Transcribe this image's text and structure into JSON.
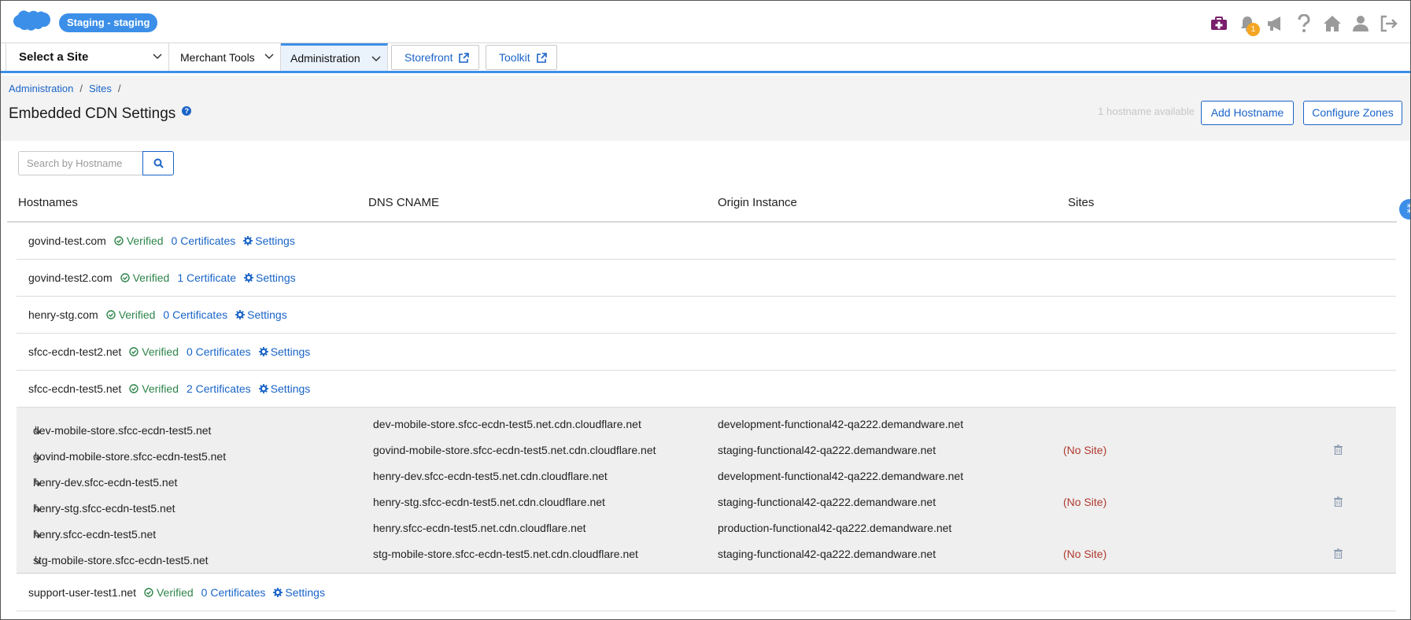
{
  "header": {
    "env_badge": "Staging - staging",
    "notification_count": "1",
    "icons": [
      "briefcase-plus-icon",
      "bell-icon",
      "megaphone-icon",
      "help-icon",
      "home-icon",
      "user-icon",
      "logout-icon"
    ],
    "brand_color": "#3c8fe8"
  },
  "nav": {
    "site_selector": "Select a Site",
    "merchant_tools": "Merchant Tools",
    "administration": "Administration",
    "storefront": "Storefront",
    "toolkit": "Toolkit"
  },
  "breadcrumb": {
    "items": [
      "Administration",
      "Sites"
    ],
    "separator": "/"
  },
  "page": {
    "title": "Embedded CDN Settings",
    "help": "?",
    "availability": "1 hostname available",
    "add_hostname": "Add Hostname",
    "configure_zones": "Configure Zones"
  },
  "search": {
    "placeholder": "Search by Hostname"
  },
  "table": {
    "columns": [
      "Hostnames",
      "DNS CNAME",
      "Origin Instance",
      "Sites"
    ],
    "side_handle": "⁑",
    "verified_label": "Verified",
    "settings_label": "Settings",
    "hostnames": [
      {
        "host": "govind-test.com",
        "certs": "0 Certificates"
      },
      {
        "host": "govind-test2.com",
        "certs": "1 Certificate"
      },
      {
        "host": "henry-stg.com",
        "certs": "0 Certificates"
      },
      {
        "host": "sfcc-ecdn-test2.net",
        "certs": "0 Certificates"
      },
      {
        "host": "sfcc-ecdn-test5.net",
        "certs": "2 Certificates"
      },
      {
        "host": "support-user-test1.net",
        "certs": "0 Certificates"
      }
    ],
    "subdomains": [
      {
        "host": "dev-mobile-store.sfcc-ecdn-test5.net",
        "cname": "dev-mobile-store.sfcc-ecdn-test5.net.cdn.cloudflare.net",
        "origin": "development-functional42-qa222.demandware.net",
        "site": ""
      },
      {
        "host": "govind-mobile-store.sfcc-ecdn-test5.net",
        "cname": "govind-mobile-store.sfcc-ecdn-test5.net.cdn.cloudflare.net",
        "origin": "staging-functional42-qa222.demandware.net",
        "site": "(No Site)"
      },
      {
        "host": "henry-dev.sfcc-ecdn-test5.net",
        "cname": "henry-dev.sfcc-ecdn-test5.net.cdn.cloudflare.net",
        "origin": "development-functional42-qa222.demandware.net",
        "site": ""
      },
      {
        "host": "henry-stg.sfcc-ecdn-test5.net",
        "cname": "henry-stg.sfcc-ecdn-test5.net.cdn.cloudflare.net",
        "origin": "staging-functional42-qa222.demandware.net",
        "site": "(No Site)"
      },
      {
        "host": "henry.sfcc-ecdn-test5.net",
        "cname": "henry.sfcc-ecdn-test5.net.cdn.cloudflare.net",
        "origin": "production-functional42-qa222.demandware.net",
        "site": ""
      },
      {
        "host": "stg-mobile-store.sfcc-ecdn-test5.net",
        "cname": "stg-mobile-store.sfcc-ecdn-test5.net.cdn.cloudflare.net",
        "origin": "staging-functional42-qa222.demandware.net",
        "site": "(No Site)"
      }
    ],
    "sub_arrow": "↳"
  }
}
